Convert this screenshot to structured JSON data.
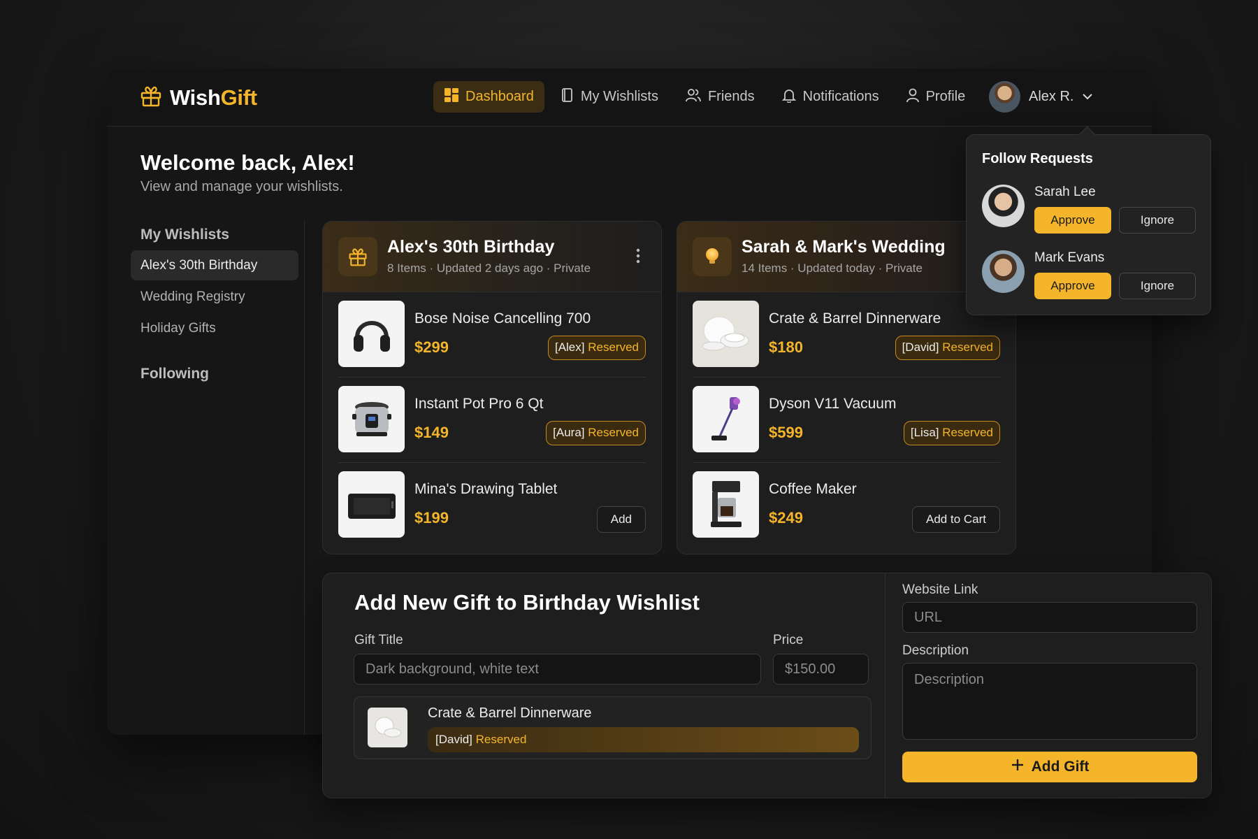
{
  "app": {
    "name_a": "Wish",
    "name_b": "Gift"
  },
  "nav": [
    {
      "label": "Dashboard",
      "icon": "dashboard-icon"
    },
    {
      "label": "My Wishlists",
      "icon": "document-icon"
    },
    {
      "label": "Friends",
      "icon": "friends-icon"
    },
    {
      "label": "Notifications",
      "icon": "bell-icon"
    },
    {
      "label": "Profile",
      "icon": "user-icon"
    }
  ],
  "user": {
    "name": "Alex R."
  },
  "welcome": {
    "title": "Welcome back, Alex!",
    "subtitle": "View and manage your wishlists."
  },
  "sidebar": {
    "heading": "My Wishlists",
    "items": [
      "Alex's 30th Birthday",
      "Wedding Registry",
      "Holiday Gifts"
    ],
    "following": "Following"
  },
  "wishlists": [
    {
      "title": "Alex's 30th Birthday",
      "meta": "8 Items · Updated 2 days ago · Private",
      "items": [
        {
          "name": "Bose Noise Cancelling 700",
          "price": "$299",
          "who": "[Alex]",
          "status": "Reserved"
        },
        {
          "name": "Instant Pot Pro 6 Qt",
          "price": "$149",
          "who": "[Aura]",
          "status": "Reserved"
        },
        {
          "name": "Mina's Drawing Tablet",
          "price": "$199",
          "button": "Add"
        }
      ]
    },
    {
      "title": "Sarah & Mark's Wedding",
      "meta": "14 Items · Updated today · Private",
      "items": [
        {
          "name": "Crate & Barrel Dinnerware",
          "price": "$180",
          "who": "[David]",
          "status": "Reserved"
        },
        {
          "name": "Dyson V11 Vacuum",
          "price": "$599",
          "who": "[Lisa]",
          "status": "Reserved"
        },
        {
          "name": "Coffee Maker",
          "price": "$249",
          "button": "Add to Cart"
        }
      ]
    }
  ],
  "follow_requests": {
    "title": "Follow Requests",
    "approve_label": "Approve",
    "ignore_label": "Ignore",
    "requests": [
      {
        "name": "Sarah Lee"
      },
      {
        "name": "Mark Evans"
      }
    ]
  },
  "add_gift": {
    "title": "Add New Gift to Birthday Wishlist",
    "gift_title_label": "Gift Title",
    "gift_title_placeholder": "Dark background, white text",
    "price_label": "Price",
    "price_placeholder": "$150.00",
    "website_label": "Website Link",
    "website_placeholder": "URL",
    "description_label": "Description",
    "description_placeholder": "Description",
    "preview": {
      "name": "Crate & Barrel Dinnerware",
      "who": "[David]",
      "status": "Reserved"
    },
    "submit_label": "Add Gift"
  },
  "colors": {
    "accent": "#f5b52a",
    "background": "#161616",
    "card": "#1e1e1e"
  }
}
